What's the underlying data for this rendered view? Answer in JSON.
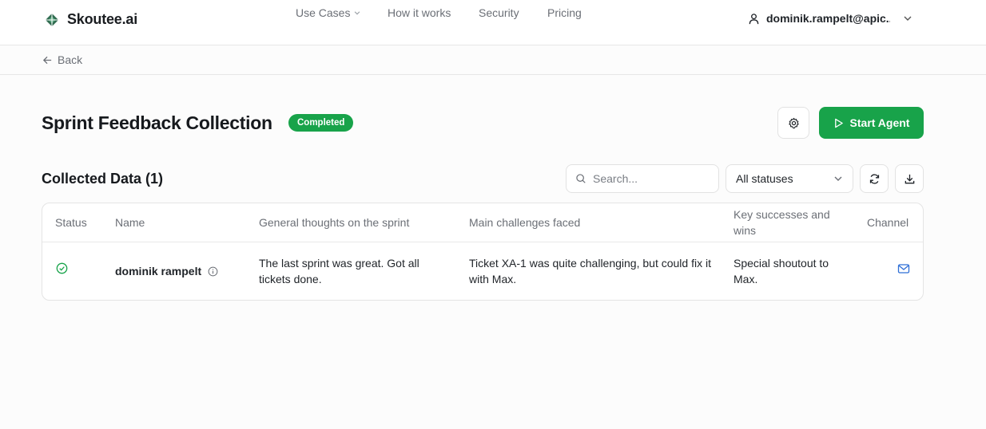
{
  "brand": {
    "name": "Skoutee.ai",
    "accent": "#18a34a"
  },
  "nav": {
    "items": [
      {
        "label": "Use Cases",
        "has_dropdown": true
      },
      {
        "label": "How it works"
      },
      {
        "label": "Security"
      },
      {
        "label": "Pricing"
      }
    ]
  },
  "user": {
    "email": "dominik.rampelt@apic..."
  },
  "back": {
    "label": "Back"
  },
  "header": {
    "title": "Sprint Feedback Collection",
    "status": "Completed",
    "start_label": "Start Agent"
  },
  "collected": {
    "title": "Collected Data (1)",
    "search_placeholder": "Search...",
    "status_filter": "All statuses"
  },
  "table": {
    "columns": {
      "status": "Status",
      "name": "Name",
      "thoughts": "General thoughts on the sprint",
      "challenges": "Main challenges faced",
      "successes": "Key successes and wins",
      "channel": "Channel"
    },
    "rows": [
      {
        "status_icon": "check-circle-icon",
        "name": "dominik rampelt",
        "thoughts": "The last sprint was great. Got all tickets done.",
        "challenges": "Ticket XA-1 was quite challenging, but could fix it with Max.",
        "successes": "Special shoutout to Max.",
        "channel_icon": "mail-icon"
      }
    ]
  }
}
